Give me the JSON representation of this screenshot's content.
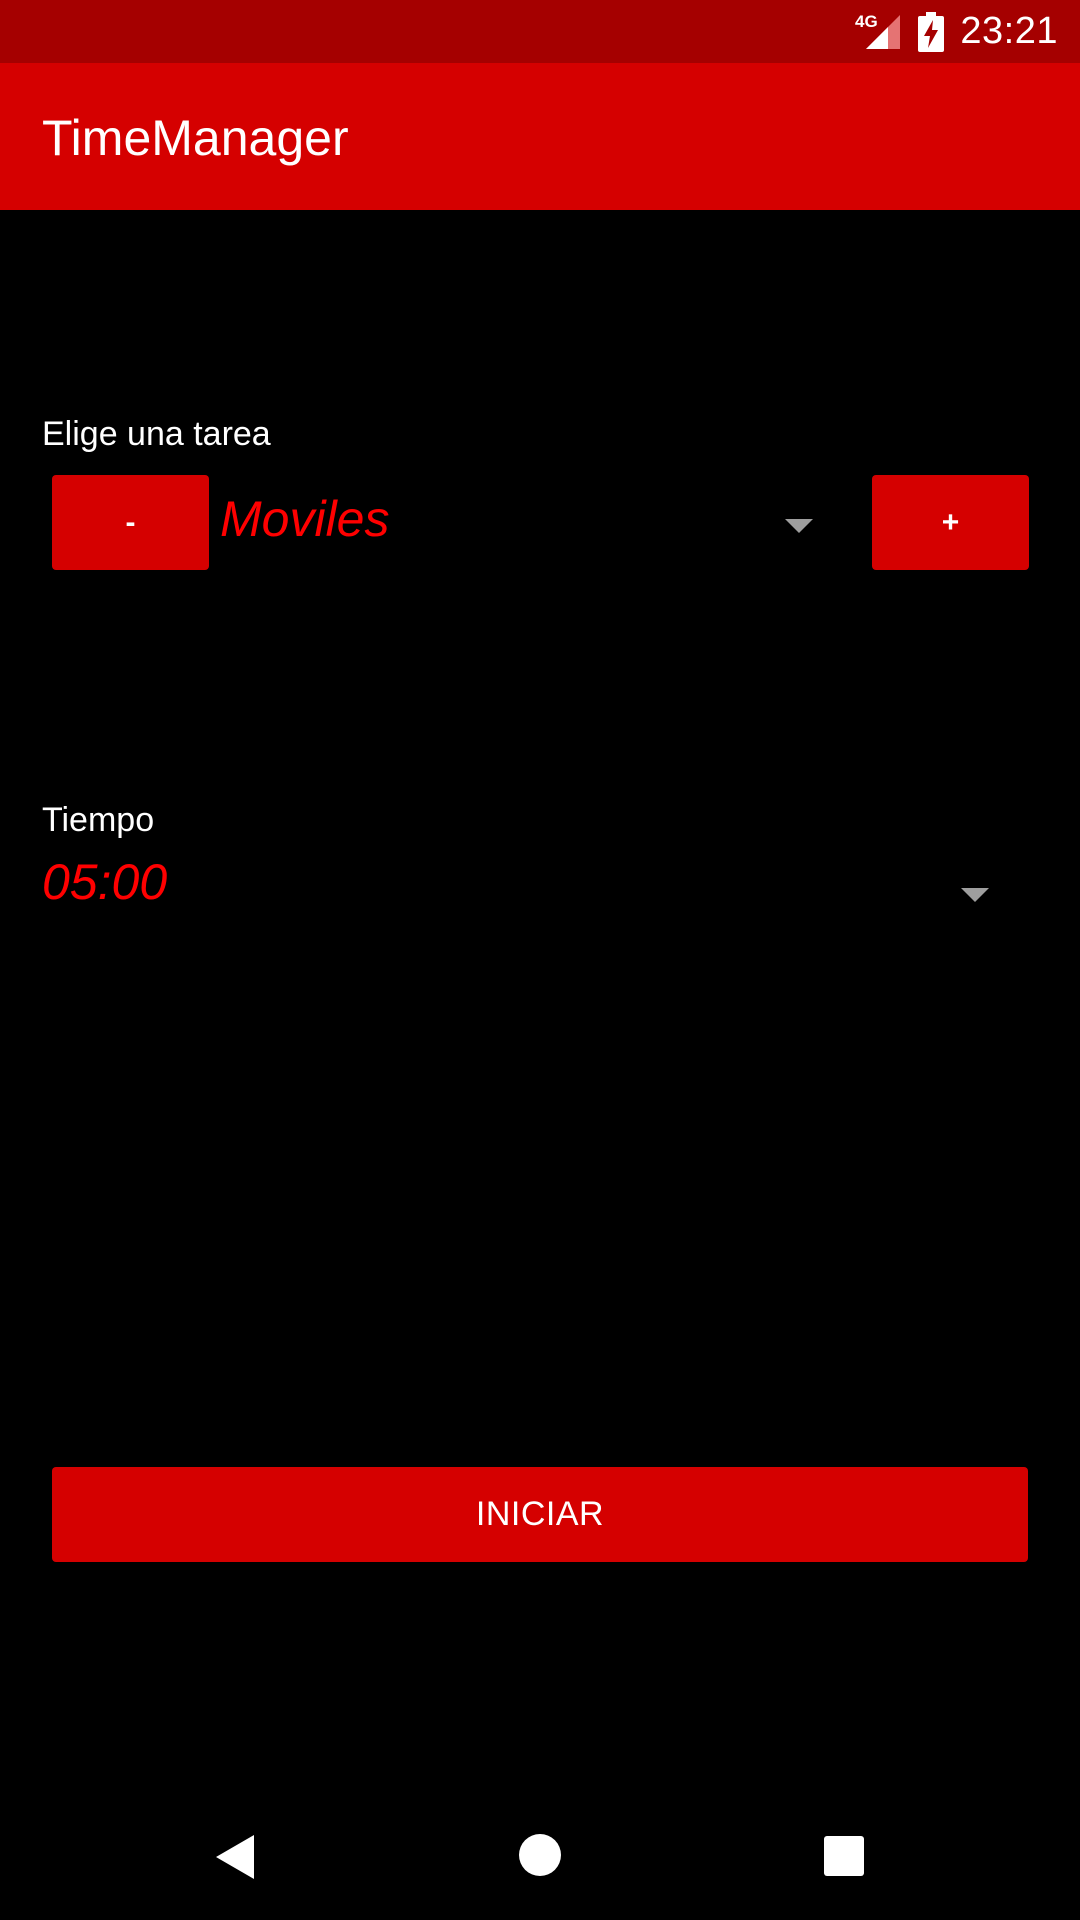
{
  "status_bar": {
    "network": "4G",
    "time": "23:21",
    "icons": [
      "signal-icon",
      "battery-charging-icon"
    ]
  },
  "app_bar": {
    "title": "TimeManager"
  },
  "task": {
    "label": "Elige una tarea",
    "decrease_label": "-",
    "selected": "Moviles",
    "increase_label": "+"
  },
  "time": {
    "label": "Tiempo",
    "selected": "05:00"
  },
  "start_button": {
    "label": "INICIAR"
  },
  "nav_bar": {
    "icons": [
      "back-icon",
      "home-icon",
      "recents-icon"
    ]
  },
  "colors": {
    "status_bar": "#a50000",
    "app_bar": "#d50000",
    "accent_text": "#ff0000",
    "background": "#000000"
  }
}
